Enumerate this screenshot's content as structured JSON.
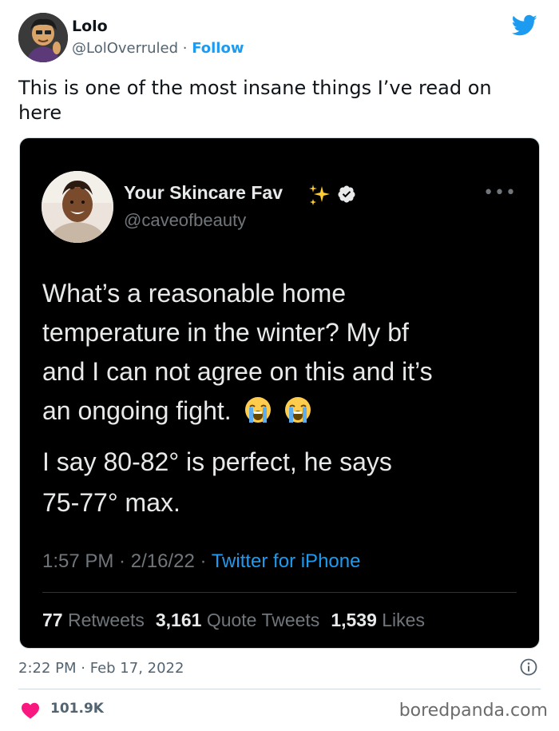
{
  "outer_tweet": {
    "author_name": "Lolo",
    "author_handle": "@LolOverruled",
    "separator": " · ",
    "follow_label": "Follow",
    "text": "This is one of the most insane things I’ve read on here",
    "time": "2:22 PM",
    "date": "Feb 17, 2022",
    "meta_separator": " · ",
    "like_count": "101.9K"
  },
  "embedded_tweet": {
    "author_name": "Your Skincare Fav",
    "author_handle": "@caveofbeauty",
    "more_label": "•••",
    "text_line_1": "What’s a reasonable home",
    "text_line_2": "temperature in the winter? My bf",
    "text_line_3": "and I can not agree on this and it’s",
    "text_line_4": "an ongoing fight.",
    "text_para_2_line_1": "I say 80-82° is perfect, he says",
    "text_para_2_line_2": "75-77° max.",
    "time": "1:57 PM",
    "date": "2/16/22",
    "meta_separator": " · ",
    "source": "Twitter for iPhone",
    "retweets": "77",
    "retweets_label": "Retweets",
    "quote_tweets": "3,161",
    "quote_tweets_label": "Quote Tweets",
    "likes": "1,539",
    "likes_label": "Likes"
  },
  "watermark": "boredpanda.com",
  "colors": {
    "twitter_blue": "#1d9bf0",
    "heart_pink": "#f91880",
    "embed_bg": "#000000",
    "dark_text": "#e7e9ea",
    "muted": "#71767b"
  },
  "icons": {
    "brand": "twitter-bird-icon",
    "verified": "verified-badge-icon",
    "sparkles": "sparkles-icon",
    "emoji": "loudly-crying-face-icon",
    "info": "info-icon",
    "like": "heart-icon"
  }
}
